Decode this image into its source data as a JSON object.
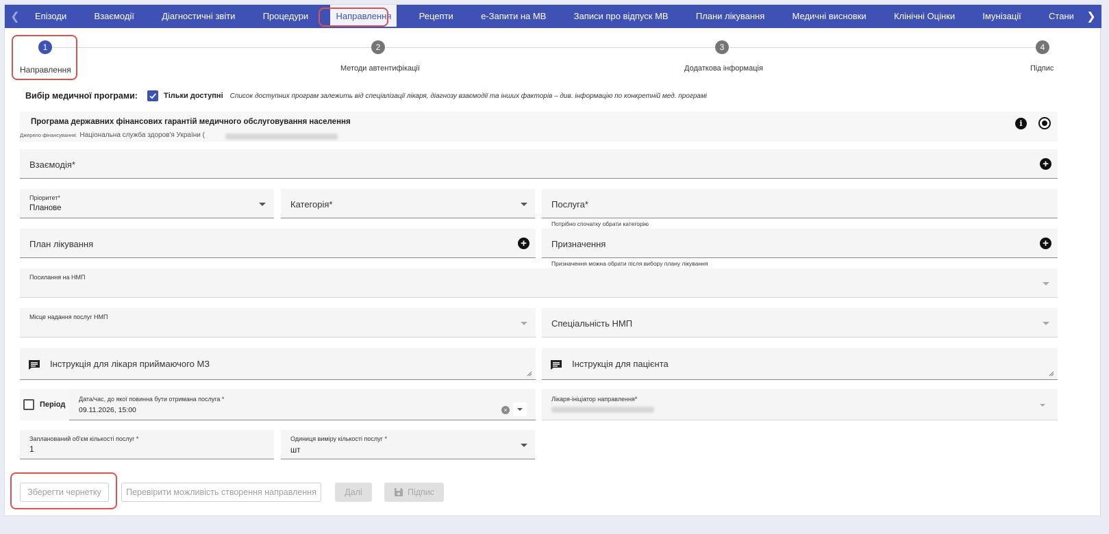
{
  "tabs": [
    "Епізоди",
    "Взаємодії",
    "Діагностичні звіти",
    "Процедури",
    "Направлення",
    "Рецепти",
    "е-Запити на МВ",
    "Записи про відпуск МВ",
    "Плани лікування",
    "Медичні висновки",
    "Клінічні Оцінки",
    "Імунізації",
    "Стани"
  ],
  "active_tab": "Направлення",
  "stepper": [
    {
      "num": "1",
      "label": "Направлення"
    },
    {
      "num": "2",
      "label": "Методи автентифікації"
    },
    {
      "num": "3",
      "label": "Додаткова інформація"
    },
    {
      "num": "4",
      "label": "Підпис"
    }
  ],
  "program_select": {
    "label": "Вибір медичної програми:",
    "only_available": "Тільки доступні",
    "note": "Список доступних програм залежить від спеціалізації лікаря, діагнозу взаємодії та інших факторів – див. інформацію по конкретній мед. програмі"
  },
  "program": {
    "name": "Програма державних фінансових гарантій медичного обслуговування населення",
    "source_label": "Джерело фінансування:",
    "source_value": "Національна служба здоров'я України ("
  },
  "form": {
    "interaction": "Взаємодія*",
    "priority_label": "Пріоритет*",
    "priority_value": "Планове",
    "category": "Категорія*",
    "service": "Послуга*",
    "service_hint": "Потрібно спочатку обрати категорію",
    "treatment_plan": "План лікування",
    "assignment": "Призначення",
    "assignment_hint": "Призначення можна обрати після вибору плану лікування",
    "emergency_ref": "Посилання на НМП",
    "emergency_place": "Місце надання послуг НМП",
    "emergency_specialty": "Спеціальність НМП",
    "instr_doctor": "Інструкція для лікаря приймаючого МЗ",
    "instr_patient": "Інструкція для пацієнта",
    "period": "Період",
    "date_label": "Дата/час, до якої повинна бути отримана послуга *",
    "date_value": "09.11.2026, 15:00",
    "initiator_label": "Лікаря-ініціатор направлення*",
    "quantity_label": "Запланований об'єм кількості послуг *",
    "quantity_value": "1",
    "unit_label": "Одиниця виміру кількості послуг *",
    "unit_value": "шт"
  },
  "buttons": {
    "save_draft": "Зберегти чернетку",
    "check": "Перевірити можливість створення направлення",
    "next": "Далі",
    "sign": "Підпис"
  },
  "colors": {
    "primary": "#3f51b5",
    "highlight": "#d9534f"
  }
}
